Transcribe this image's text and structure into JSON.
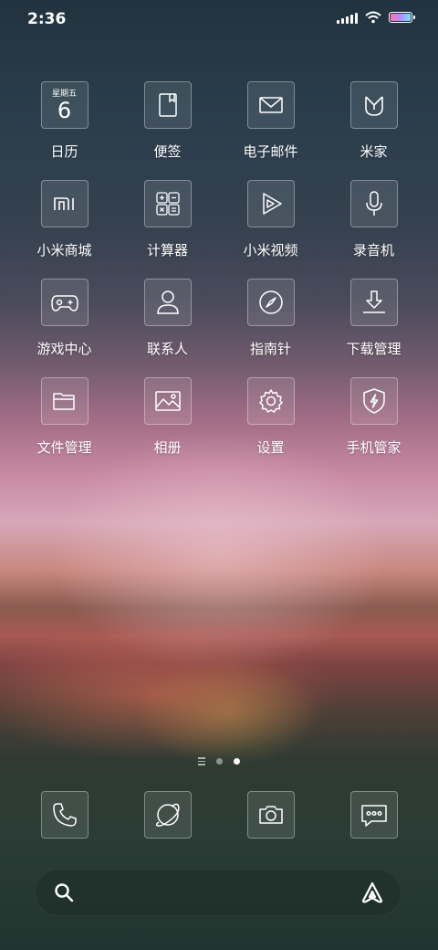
{
  "status_bar": {
    "time": "2:36",
    "battery_level": 1.0
  },
  "calendar": {
    "weekday": "星期五",
    "day": "6"
  },
  "apps": [
    {
      "label": "日历",
      "icon": "calendar-icon"
    },
    {
      "label": "便签",
      "icon": "notes-icon"
    },
    {
      "label": "电子邮件",
      "icon": "mail-icon"
    },
    {
      "label": "米家",
      "icon": "mijia-icon"
    },
    {
      "label": "小米商城",
      "icon": "mi-store-icon"
    },
    {
      "label": "计算器",
      "icon": "calculator-icon"
    },
    {
      "label": "小米视频",
      "icon": "video-play-icon"
    },
    {
      "label": "录音机",
      "icon": "microphone-icon"
    },
    {
      "label": "游戏中心",
      "icon": "gamepad-icon"
    },
    {
      "label": "联系人",
      "icon": "contact-person-icon"
    },
    {
      "label": "指南针",
      "icon": "compass-icon"
    },
    {
      "label": "下载管理",
      "icon": "download-icon"
    },
    {
      "label": "文件管理",
      "icon": "folder-icon"
    },
    {
      "label": "相册",
      "icon": "gallery-icon"
    },
    {
      "label": "设置",
      "icon": "gear-icon"
    },
    {
      "label": "手机管家",
      "icon": "shield-bolt-icon"
    }
  ],
  "page_indicator": {
    "pages": 2,
    "current": 2
  },
  "dock": [
    {
      "icon": "phone-icon"
    },
    {
      "icon": "browser-planet-icon"
    },
    {
      "icon": "camera-icon"
    },
    {
      "icon": "message-icon"
    }
  ],
  "search_bar": {
    "left_icon": "search-icon",
    "right_icon": "assistant-icon"
  }
}
